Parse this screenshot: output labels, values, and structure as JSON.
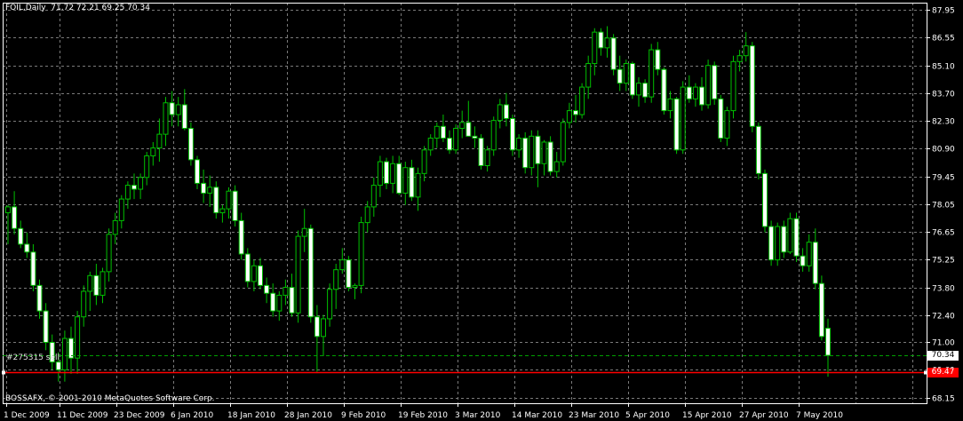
{
  "header": {
    "symbol": "FOIL,Daily",
    "ohlc": "71.72 72.21 69.25 70.34"
  },
  "order_line": {
    "label": "#275315 sell",
    "price": "69.47"
  },
  "copyright": "BOSSAFX, © 2001-2010 MetaQuotes Software Corp.",
  "last_price": "70.34",
  "colors": {
    "background": "#000000",
    "grid": "#7a7a7a",
    "bull": "#00c000",
    "bear_body": "#ffffff",
    "order_line": "#ff0000",
    "axis": "#ffffff"
  },
  "chart_data": {
    "type": "candlestick",
    "ylim": [
      67.9,
      88.3
    ],
    "y_ticks": [
      "87.95",
      "86.55",
      "85.10",
      "83.70",
      "82.30",
      "80.90",
      "79.45",
      "78.05",
      "76.65",
      "75.25",
      "73.80",
      "72.40",
      "71.00",
      "69.60",
      "68.15"
    ],
    "x_ticks": [
      "1 Dec 2009",
      "11 Dec 2009",
      "23 Dec 2009",
      "6 Jan 2010",
      "18 Jan 2010",
      "28 Jan 2010",
      "9 Feb 2010",
      "19 Feb 2010",
      "3 Mar 2010",
      "14 Mar 2010",
      "23 Mar 2010",
      "5 Apr 2010",
      "15 Apr 2010",
      "27 Apr 2010",
      "7 May 2010"
    ],
    "candles": [
      [
        77.6,
        78.0,
        76.0,
        77.9
      ],
      [
        77.9,
        78.7,
        76.5,
        76.8
      ],
      [
        76.8,
        77.2,
        75.8,
        76.0
      ],
      [
        76.0,
        76.6,
        75.3,
        75.6
      ],
      [
        75.6,
        76.0,
        73.6,
        73.9
      ],
      [
        73.9,
        74.2,
        72.2,
        72.6
      ],
      [
        72.6,
        73.0,
        70.6,
        71.0
      ],
      [
        71.0,
        71.4,
        69.6,
        70.0
      ],
      [
        70.0,
        70.5,
        69.0,
        69.6
      ],
      [
        69.6,
        71.6,
        69.0,
        71.2
      ],
      [
        71.2,
        71.8,
        69.4,
        70.2
      ],
      [
        70.2,
        72.6,
        69.4,
        72.3
      ],
      [
        72.3,
        73.9,
        71.8,
        73.6
      ],
      [
        73.6,
        74.6,
        72.6,
        74.4
      ],
      [
        74.4,
        75.0,
        72.9,
        73.4
      ],
      [
        73.4,
        74.8,
        73.0,
        74.6
      ],
      [
        74.6,
        76.8,
        74.1,
        76.5
      ],
      [
        76.5,
        77.6,
        76.0,
        77.2
      ],
      [
        77.2,
        78.5,
        76.8,
        78.3
      ],
      [
        78.3,
        79.2,
        77.8,
        79.0
      ],
      [
        79.0,
        79.6,
        78.3,
        78.8
      ],
      [
        78.8,
        79.6,
        78.3,
        79.4
      ],
      [
        79.4,
        80.7,
        79.0,
        80.5
      ],
      [
        80.5,
        81.2,
        80.0,
        80.9
      ],
      [
        80.9,
        82.4,
        80.2,
        81.6
      ],
      [
        81.6,
        83.5,
        81.0,
        83.2
      ],
      [
        83.2,
        83.8,
        82.0,
        82.6
      ],
      [
        82.6,
        83.5,
        82.0,
        83.1
      ],
      [
        83.1,
        83.9,
        81.8,
        81.9
      ],
      [
        81.9,
        82.2,
        80.0,
        80.3
      ],
      [
        80.3,
        80.5,
        78.8,
        79.1
      ],
      [
        79.1,
        79.8,
        78.1,
        78.6
      ],
      [
        78.6,
        79.5,
        77.9,
        78.9
      ],
      [
        78.9,
        79.2,
        77.3,
        77.6
      ],
      [
        77.6,
        78.0,
        77.1,
        77.8
      ],
      [
        77.8,
        78.9,
        77.3,
        78.7
      ],
      [
        78.7,
        79.0,
        76.9,
        77.2
      ],
      [
        77.2,
        77.6,
        75.2,
        75.5
      ],
      [
        75.5,
        75.8,
        73.8,
        74.1
      ],
      [
        74.1,
        75.2,
        73.6,
        74.9
      ],
      [
        74.9,
        75.3,
        73.7,
        73.9
      ],
      [
        73.9,
        74.3,
        73.0,
        73.5
      ],
      [
        73.5,
        74.0,
        72.3,
        72.6
      ],
      [
        72.6,
        73.6,
        72.1,
        73.4
      ],
      [
        73.4,
        74.2,
        72.9,
        73.8
      ],
      [
        73.8,
        74.5,
        72.3,
        72.5
      ],
      [
        72.5,
        76.7,
        72.0,
        76.4
      ],
      [
        76.4,
        77.8,
        75.6,
        76.8
      ],
      [
        76.8,
        77.0,
        72.0,
        72.3
      ],
      [
        72.3,
        72.9,
        69.5,
        71.3
      ],
      [
        71.3,
        72.4,
        70.3,
        72.2
      ],
      [
        72.2,
        74.0,
        71.8,
        73.7
      ],
      [
        73.7,
        75.0,
        72.7,
        74.7
      ],
      [
        74.7,
        75.8,
        74.5,
        75.2
      ],
      [
        75.2,
        75.4,
        73.6,
        73.8
      ],
      [
        73.8,
        74.0,
        73.2,
        73.9
      ],
      [
        73.9,
        77.4,
        73.5,
        77.1
      ],
      [
        77.1,
        78.2,
        76.6,
        77.9
      ],
      [
        77.9,
        79.4,
        77.4,
        79.0
      ],
      [
        79.0,
        80.5,
        78.4,
        80.2
      ],
      [
        80.2,
        80.4,
        78.8,
        79.1
      ],
      [
        79.1,
        80.5,
        78.6,
        80.1
      ],
      [
        80.1,
        80.5,
        78.5,
        78.6
      ],
      [
        78.6,
        80.2,
        78.0,
        79.9
      ],
      [
        79.9,
        80.3,
        78.2,
        78.4
      ],
      [
        78.4,
        79.9,
        77.7,
        79.6
      ],
      [
        79.6,
        81.0,
        79.2,
        80.8
      ],
      [
        80.8,
        81.6,
        80.5,
        81.4
      ],
      [
        81.4,
        82.2,
        80.9,
        82.0
      ],
      [
        82.0,
        82.6,
        81.2,
        81.4
      ],
      [
        81.4,
        81.8,
        80.6,
        80.8
      ],
      [
        80.8,
        82.1,
        80.6,
        81.9
      ],
      [
        81.9,
        82.8,
        81.4,
        82.2
      ],
      [
        82.2,
        83.3,
        81.7,
        81.5
      ],
      [
        81.5,
        82.0,
        80.9,
        81.4
      ],
      [
        81.4,
        81.6,
        79.8,
        80.0
      ],
      [
        80.0,
        81.0,
        79.7,
        80.8
      ],
      [
        80.8,
        82.5,
        80.5,
        82.3
      ],
      [
        82.3,
        83.4,
        81.9,
        83.1
      ],
      [
        83.1,
        83.7,
        82.0,
        82.4
      ],
      [
        82.4,
        82.6,
        80.5,
        80.8
      ],
      [
        80.8,
        81.6,
        80.4,
        81.4
      ],
      [
        81.4,
        81.7,
        79.6,
        79.9
      ],
      [
        79.9,
        81.8,
        79.5,
        81.5
      ],
      [
        81.5,
        81.8,
        78.9,
        80.1
      ],
      [
        80.1,
        81.3,
        79.5,
        81.2
      ],
      [
        81.2,
        81.5,
        79.5,
        79.7
      ],
      [
        79.7,
        80.7,
        79.4,
        80.2
      ],
      [
        80.2,
        82.4,
        80.0,
        82.2
      ],
      [
        82.2,
        83.2,
        81.9,
        82.8
      ],
      [
        82.8,
        83.6,
        82.2,
        82.6
      ],
      [
        82.6,
        84.2,
        82.4,
        84.0
      ],
      [
        84.0,
        85.6,
        83.4,
        85.2
      ],
      [
        85.2,
        87.0,
        84.6,
        86.8
      ],
      [
        86.8,
        87.0,
        85.6,
        86.0
      ],
      [
        86.0,
        87.1,
        85.5,
        86.5
      ],
      [
        86.5,
        86.7,
        84.6,
        84.9
      ],
      [
        84.9,
        85.6,
        83.8,
        84.2
      ],
      [
        84.2,
        85.4,
        83.8,
        85.2
      ],
      [
        85.2,
        85.3,
        83.4,
        83.6
      ],
      [
        83.6,
        84.5,
        83.0,
        84.2
      ],
      [
        84.2,
        84.4,
        83.2,
        83.5
      ],
      [
        83.5,
        86.2,
        83.2,
        85.9
      ],
      [
        85.9,
        86.3,
        84.6,
        84.9
      ],
      [
        84.9,
        85.0,
        82.6,
        82.8
      ],
      [
        82.8,
        83.8,
        82.4,
        83.4
      ],
      [
        83.4,
        83.5,
        80.6,
        80.8
      ],
      [
        80.8,
        84.3,
        80.6,
        84.0
      ],
      [
        84.0,
        84.6,
        83.2,
        83.4
      ],
      [
        83.4,
        84.2,
        83.0,
        84.0
      ],
      [
        84.0,
        84.5,
        82.8,
        83.1
      ],
      [
        83.1,
        85.4,
        82.9,
        85.1
      ],
      [
        85.1,
        85.3,
        83.1,
        83.4
      ],
      [
        83.4,
        83.6,
        81.2,
        81.4
      ],
      [
        81.4,
        83.0,
        81.0,
        82.8
      ],
      [
        82.8,
        85.6,
        82.4,
        85.3
      ],
      [
        85.3,
        85.9,
        84.8,
        85.6
      ],
      [
        85.6,
        86.8,
        85.3,
        86.1
      ],
      [
        86.1,
        86.3,
        81.7,
        82.0
      ],
      [
        82.0,
        82.2,
        79.3,
        79.6
      ],
      [
        79.6,
        79.8,
        76.6,
        76.9
      ],
      [
        76.9,
        77.2,
        74.9,
        75.2
      ],
      [
        75.2,
        77.1,
        74.9,
        76.9
      ],
      [
        76.9,
        77.2,
        75.3,
        75.6
      ],
      [
        75.6,
        77.6,
        75.5,
        77.3
      ],
      [
        77.3,
        77.6,
        75.1,
        75.4
      ],
      [
        75.4,
        75.8,
        74.6,
        74.9
      ],
      [
        74.9,
        76.5,
        74.6,
        76.1
      ],
      [
        76.1,
        76.8,
        73.7,
        74.0
      ],
      [
        74.0,
        74.4,
        71.1,
        71.3
      ],
      [
        71.72,
        72.21,
        69.25,
        70.34
      ]
    ]
  }
}
